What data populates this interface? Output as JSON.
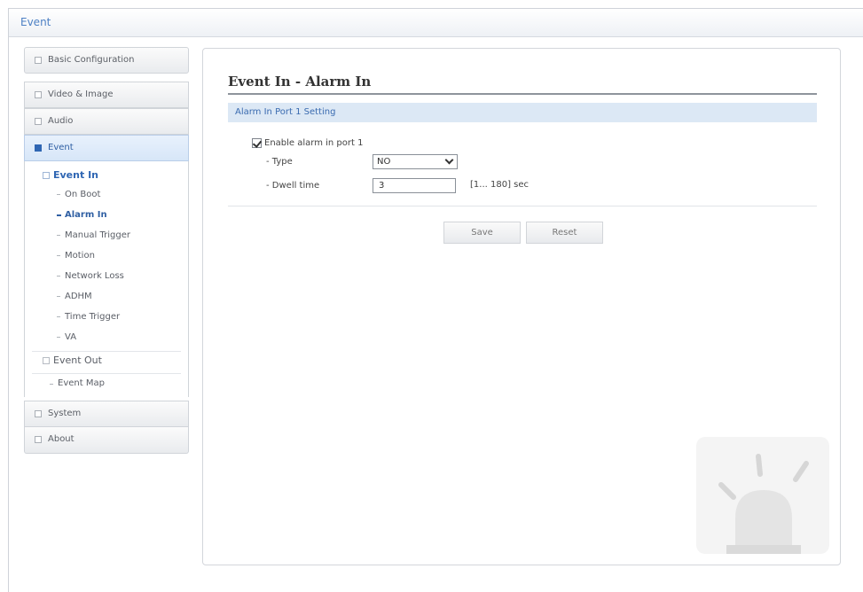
{
  "topbar": {
    "title": "Event"
  },
  "sidebar": {
    "menus": [
      {
        "label": "Basic Configuration"
      },
      {
        "label": "Video & Image"
      },
      {
        "label": "Audio"
      },
      {
        "label": "Event"
      },
      {
        "label": "System"
      },
      {
        "label": "About"
      }
    ],
    "event_in": {
      "label": "Event In",
      "items": [
        "On Boot",
        "Alarm In",
        "Manual Trigger",
        "Motion",
        "Network Loss",
        "ADHM",
        "Time Trigger",
        "VA"
      ]
    },
    "event_out": {
      "label": "Event Out"
    },
    "event_map": {
      "label": "Event Map"
    }
  },
  "content": {
    "title": "Event In - Alarm In",
    "section": "Alarm In Port 1 Setting",
    "enable_label": "Enable alarm in port 1",
    "enable_checked": true,
    "type_label": "- Type",
    "type_value": "NO",
    "dwell_label": "- Dwell time",
    "dwell_value": "3",
    "dwell_range": "[1... 180] sec",
    "save_label": "Save",
    "reset_label": "Reset"
  },
  "colors": {
    "accent": "#2f66b3",
    "section_bg": "#dce8f5",
    "title_blue": "#4d80c4"
  },
  "icons": {
    "menu_marker": "square-bullet-icon",
    "decoration": "alarm-siren-icon"
  }
}
